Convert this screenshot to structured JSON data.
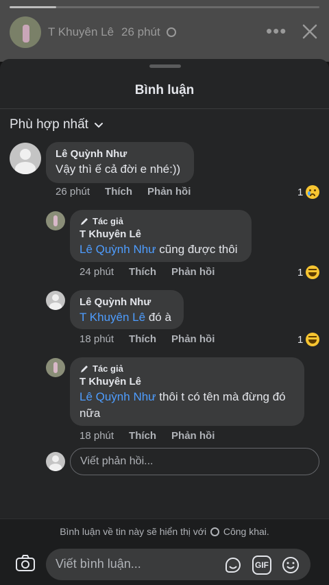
{
  "story": {
    "author": "T Khuyên Lê",
    "time": "26 phút",
    "progress": 0.15
  },
  "sheet": {
    "title": "Bình luận",
    "sort_label": "Phù hợp nhất"
  },
  "comments": [
    {
      "name": "Lê Quỳnh Như",
      "text": "Vậy thì ế cả đời e nhé:))",
      "time": "26 phút",
      "like": "Thích",
      "reply": "Phản hồi",
      "reaction_count": "1",
      "reaction": "sad-tear-emoji"
    },
    {
      "badge": "Tác giả",
      "name": "T Khuyên Lê",
      "mention": "Lê Quỳnh Như",
      "text": " cũng được thôi",
      "time": "24 phút",
      "like": "Thích",
      "reply": "Phản hồi",
      "reaction_count": "1",
      "reaction": "laugh-emoji"
    },
    {
      "name": "Lê Quỳnh Như",
      "mention": "T Khuyên Lê",
      "text": " đó à",
      "time": "18 phút",
      "like": "Thích",
      "reply": "Phản hồi",
      "reaction_count": "1",
      "reaction": "laugh-emoji"
    },
    {
      "badge": "Tác giả",
      "name": "T Khuyên Lê",
      "mention": "Lê Quỳnh Như",
      "text": " thôi t có tên mà đừng đó nữa",
      "time": "18 phút",
      "like": "Thích",
      "reply": "Phản hồi"
    }
  ],
  "reply_box": {
    "placeholder": "Viết phản hồi..."
  },
  "footer": {
    "notice_before": "Bình luận về tin này sẽ hiển thị với",
    "notice_after": "Công khai.",
    "comment_placeholder": "Viết bình luận...",
    "gif_label": "GIF"
  },
  "colors": {
    "sheet_bg": "#242526",
    "bubble_bg": "#3a3b3c",
    "mention": "#4e9dff",
    "secondary_text": "#b0b3b8"
  }
}
